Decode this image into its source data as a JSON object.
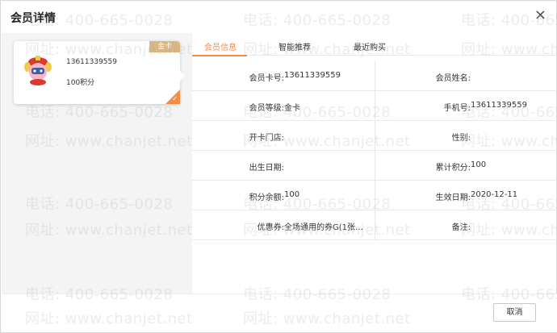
{
  "dialog": {
    "title": "会员详情",
    "close_label": "×"
  },
  "card": {
    "grade_badge": "金卡",
    "phone": "13611339559",
    "points": "100积分"
  },
  "tabs": [
    {
      "label": "会员信息",
      "active": true
    },
    {
      "label": "智能推荐",
      "active": false
    },
    {
      "label": "最近购买",
      "active": false
    }
  ],
  "info": {
    "rows": [
      {
        "left_label": "会员卡号:",
        "left_value": "13611339559",
        "right_label": "会员姓名:",
        "right_value": ""
      },
      {
        "left_label": "会员等级:",
        "left_value": "金卡",
        "right_label": "手机号:",
        "right_value": "13611339559"
      },
      {
        "left_label": "开卡门店:",
        "left_value": "",
        "right_label": "性别:",
        "right_value": ""
      },
      {
        "left_label": "出生日期:",
        "left_value": "",
        "right_label": "累计积分:",
        "right_value": "100"
      },
      {
        "left_label": "积分余额:",
        "left_value": "100",
        "right_label": "生效日期:",
        "right_value": "2020-12-11"
      },
      {
        "left_label": "优惠券:",
        "left_value": "全场通用的券G(1张…",
        "right_label": "备注:",
        "right_value": ""
      }
    ]
  },
  "watermark": {
    "phone": "电话: 400-665-0028",
    "site": "网址: www.chanjet.net"
  },
  "footer": {
    "cancel_label": "取消"
  },
  "colors": {
    "accent": "#f08d49",
    "badge": "#d9b783",
    "panel_bg": "#f4f4f4"
  }
}
